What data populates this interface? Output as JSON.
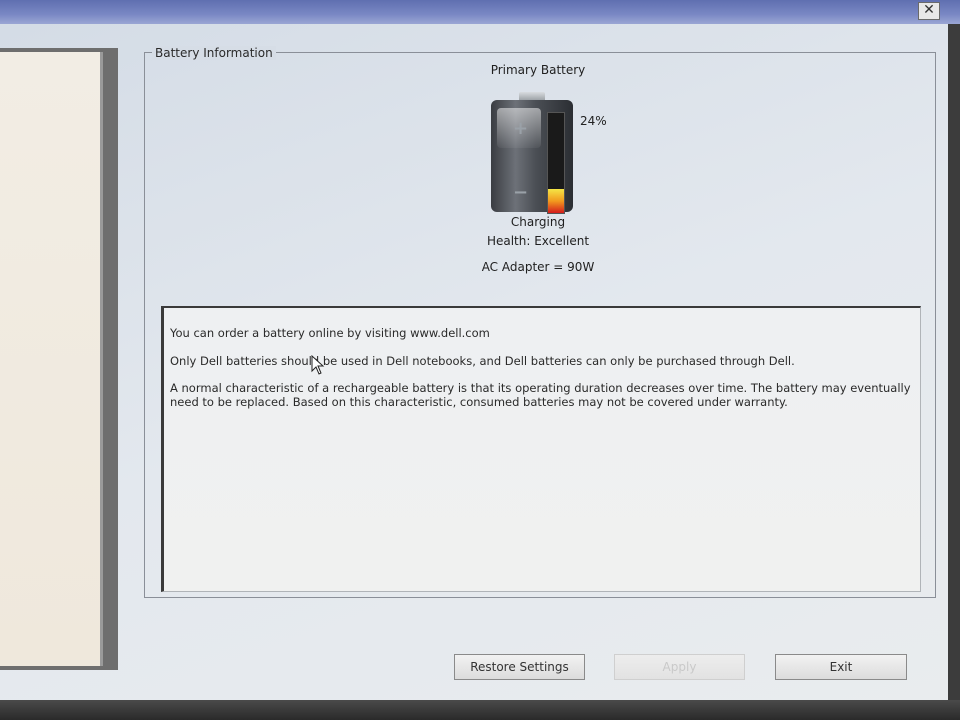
{
  "window": {
    "close_label": "✕"
  },
  "group": {
    "title": "Battery Information"
  },
  "battery": {
    "name": "Primary Battery",
    "charge_percent": 24,
    "charge_label": "24%",
    "status": "Charging",
    "health": "Health: Excellent",
    "adapter": "AC Adapter = 90W",
    "gauge_colors": [
      "#f5e646",
      "#f29a1e",
      "#d41c1c"
    ]
  },
  "info": {
    "line1": "You can order a battery online by visiting www.dell.com",
    "line2": "Only Dell batteries should be used in Dell notebooks, and Dell batteries can only be purchased through Dell.",
    "line3": "A normal characteristic of a rechargeable battery is that its operating duration decreases over time.  The battery may eventually need to be replaced.  Based on this characteristic, consumed batteries may not be covered under warranty."
  },
  "buttons": {
    "restore": "Restore Settings",
    "apply": "Apply",
    "exit": "Exit"
  }
}
